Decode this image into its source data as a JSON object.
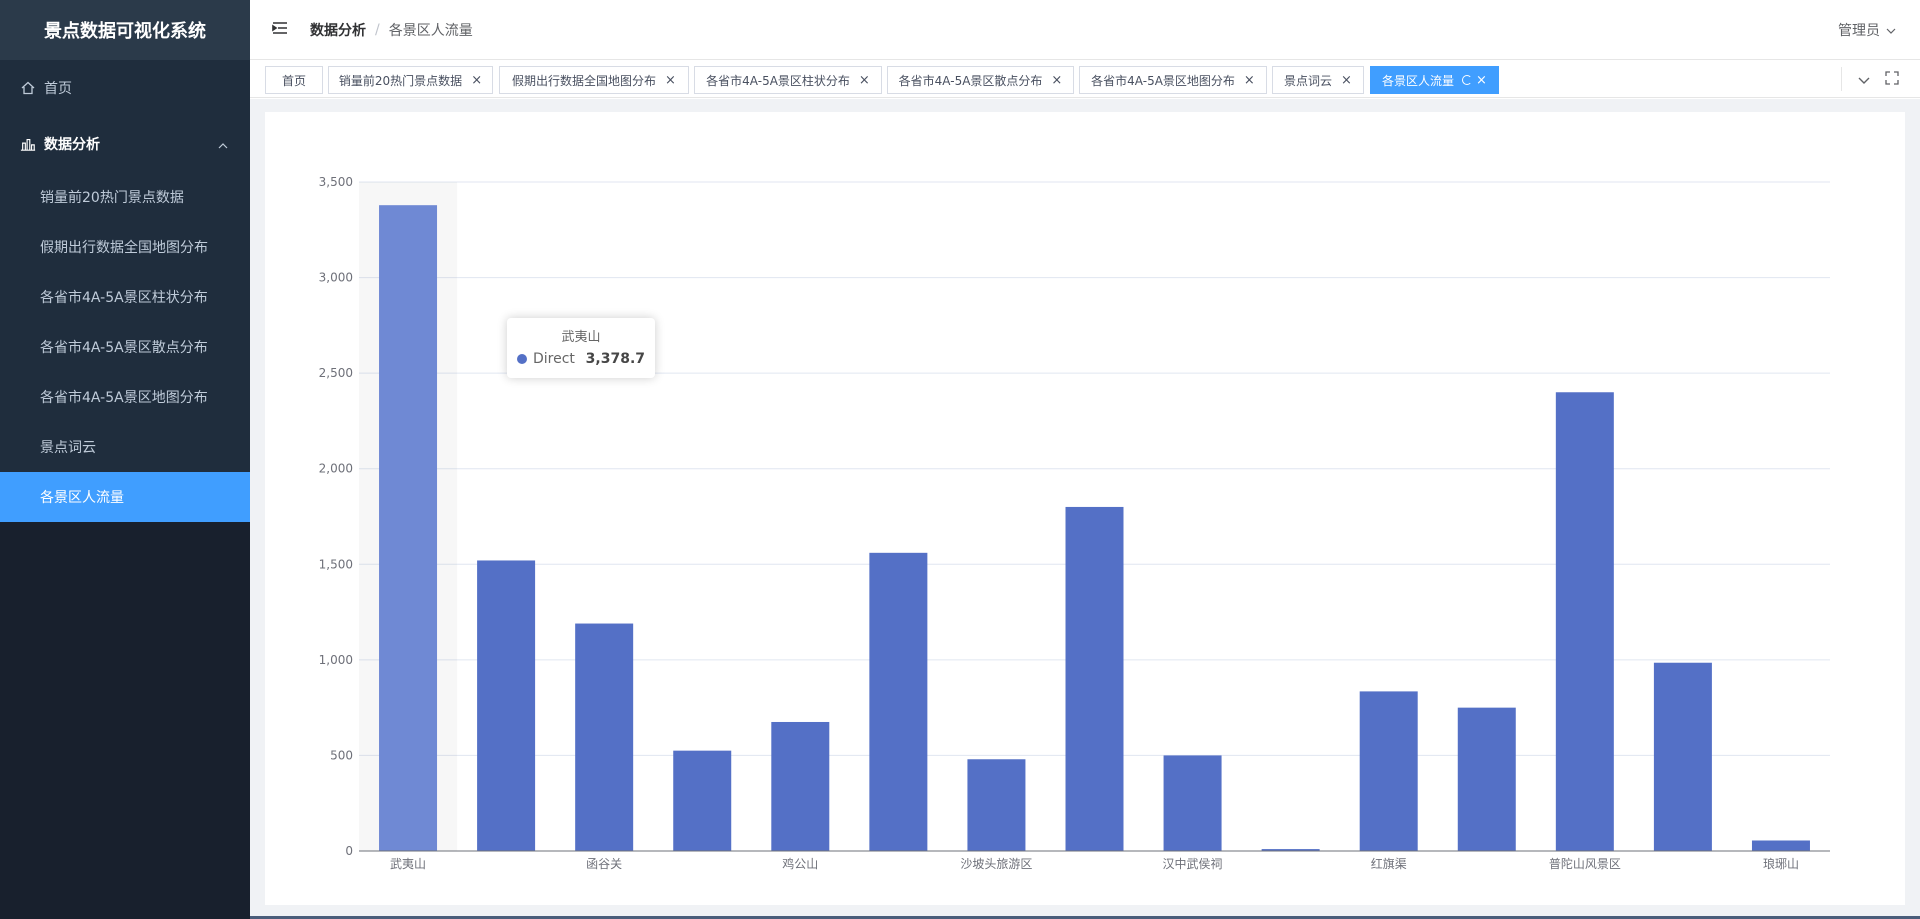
{
  "app": {
    "title": "景点数据可视化系统"
  },
  "sidebar": {
    "home": "首页",
    "group": "数据分析",
    "items": [
      {
        "label": "销量前20热门景点数据"
      },
      {
        "label": "假期出行数据全国地图分布"
      },
      {
        "label": "各省市4A-5A景区柱状分布"
      },
      {
        "label": "各省市4A-5A景区散点分布"
      },
      {
        "label": "各省市4A-5A景区地图分布"
      },
      {
        "label": "景点词云"
      },
      {
        "label": "各景区人流量"
      }
    ],
    "active_index": 6,
    "colors": {
      "bg": "#1f2d3d",
      "active": "#409eff"
    }
  },
  "header": {
    "breadcrumb": [
      "数据分析",
      "各景区人流量"
    ],
    "user": "管理员"
  },
  "tags": [
    {
      "label": "首页",
      "closable": false
    },
    {
      "label": "销量前20热门景点数据",
      "closable": true
    },
    {
      "label": "假期出行数据全国地图分布",
      "closable": true
    },
    {
      "label": "各省市4A-5A景区柱状分布",
      "closable": true
    },
    {
      "label": "各省市4A-5A景区散点分布",
      "closable": true
    },
    {
      "label": "各省市4A-5A景区地图分布",
      "closable": true
    },
    {
      "label": "景点词云",
      "closable": true
    },
    {
      "label": "各景区人流量",
      "closable": true,
      "active": true
    }
  ],
  "chart_data": {
    "type": "bar",
    "categories": [
      "武夷山",
      "",
      "函谷关",
      "",
      "鸡公山",
      "",
      "沙坡头旅游区",
      "",
      "汉中武侯祠",
      "",
      "红旗渠",
      "",
      "普陀山风景区",
      "",
      "琅琊山"
    ],
    "series": [
      {
        "name": "Direct",
        "values": [
          3378.7,
          1520,
          1190,
          525,
          675,
          1560,
          480,
          1800,
          500,
          10,
          835,
          750,
          2400,
          985,
          55
        ],
        "color": "#5470c6"
      }
    ],
    "ylim": [
      0,
      3500
    ],
    "yticks": [
      "0",
      "500",
      "1,000",
      "1,500",
      "2,000",
      "2,500",
      "3,000",
      "3,500"
    ],
    "grid": true,
    "highlight_index": 0,
    "tooltip": {
      "title": "武夷山",
      "series": "Direct",
      "value": "3,378.7"
    }
  }
}
